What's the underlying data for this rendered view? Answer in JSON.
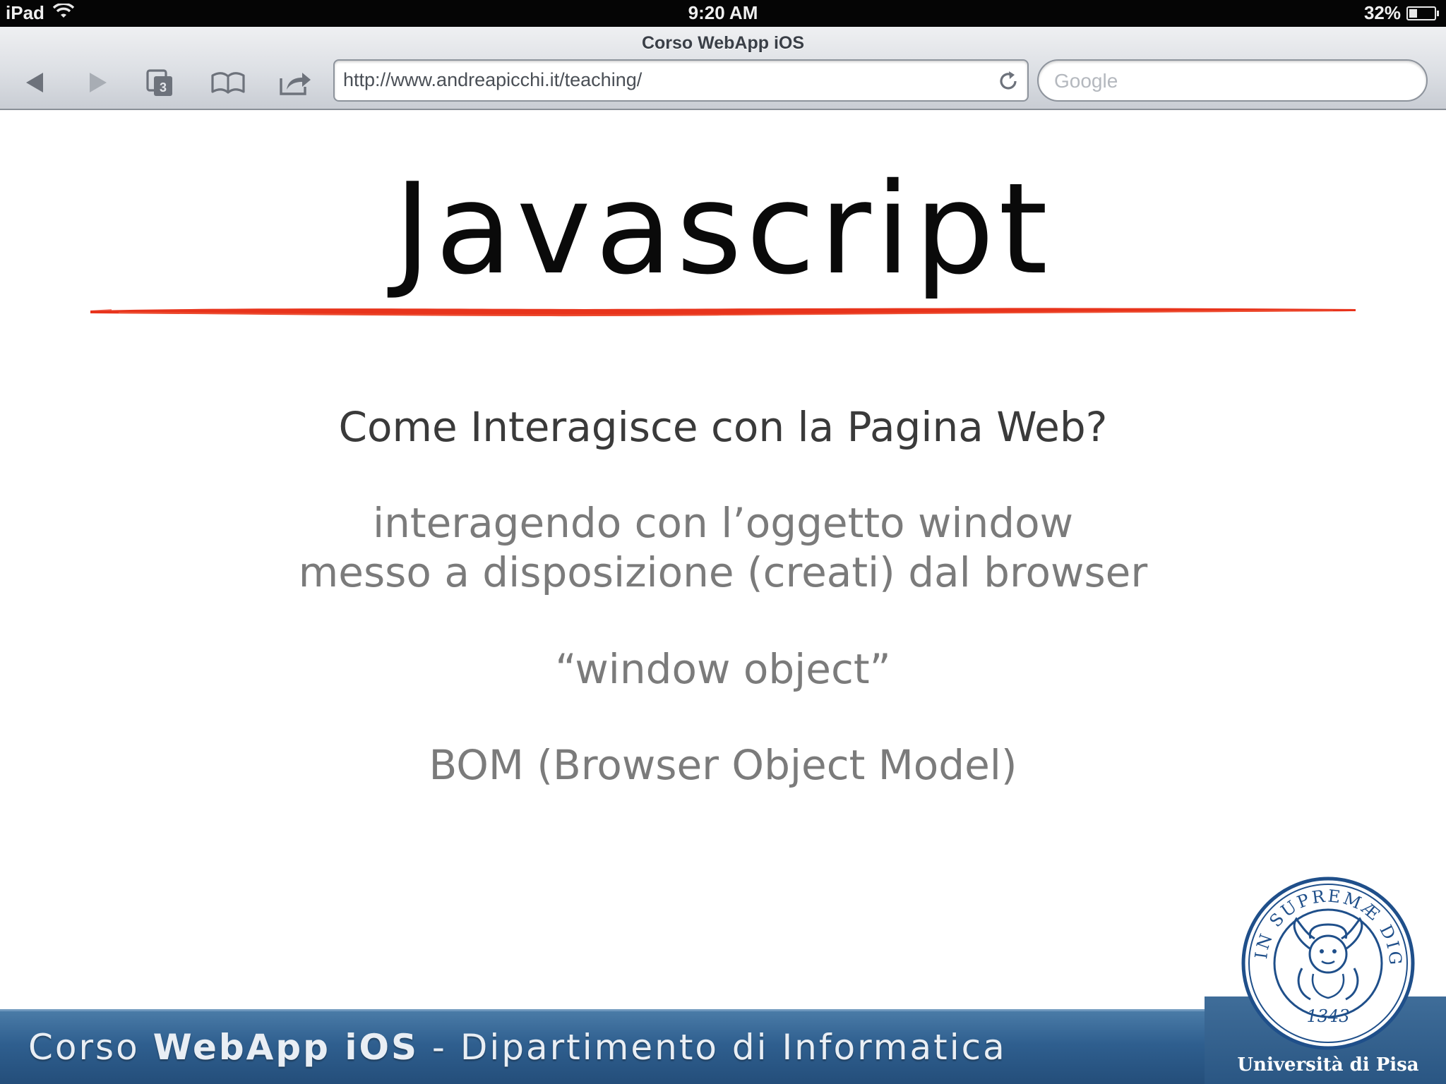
{
  "status_bar": {
    "device": "iPad",
    "time": "9:20 AM",
    "battery": "32%",
    "battery_level": 0.32
  },
  "browser": {
    "title": "Corso WebApp iOS",
    "url": "http://www.andreapicchi.it/teaching/",
    "search_placeholder": "Google",
    "tabs_count": "3"
  },
  "slide": {
    "title": "Javascript",
    "question": "Come Interagisce con la Pagina Web?",
    "line1": "interagendo con l’oggetto window",
    "line2": "messo a disposizione (creati) dal browser",
    "line3": "“window object”",
    "line4": "BOM (Browser Object Model)"
  },
  "footer": {
    "prefix": "Corso ",
    "course": "WebApp iOS",
    "department": " - Dipartimento di Informatica",
    "university": "Università di Pisa"
  },
  "colors": {
    "brush_red": "#e8341c",
    "footer_blue": "#2f5f8f",
    "seal_blue": "#1f4f8a"
  }
}
